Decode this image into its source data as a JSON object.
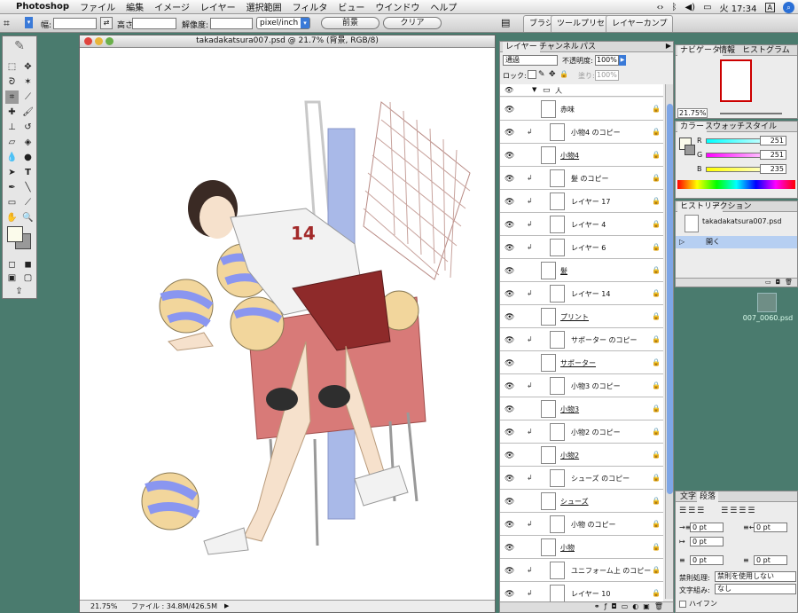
{
  "menubar": {
    "app": "Photoshop",
    "items": [
      "ファイル",
      "編集",
      "イメージ",
      "レイヤー",
      "選択範囲",
      "フィルタ",
      "ビュー",
      "ウインドウ",
      "ヘルプ"
    ],
    "clock": "火 17:34"
  },
  "options": {
    "width_label": "幅:",
    "height_label": "高さ:",
    "resolution_label": "解像度:",
    "unit": "pixel/inch",
    "front_btn": "前景",
    "clear_btn": "クリア",
    "well_tabs": [
      "ブラシ",
      "ツールプリセット",
      "レイヤーカンプ"
    ]
  },
  "document": {
    "title": "takadakatsura007.psd @ 21.7% (背景, RGB/8)",
    "zoom": "21.75%",
    "file_info": "ファイル : 34.8M/426.5M"
  },
  "layers": {
    "tabs": [
      "レイヤー",
      "チャンネル",
      "パス"
    ],
    "blend": "通過",
    "opacity_label": "不透明度:",
    "opacity": "100%",
    "lock_label": "ロック:",
    "fill_label": "塗り:",
    "fill": "100%",
    "group": "人",
    "rows": [
      {
        "name": "赤味",
        "link": false,
        "indent": false,
        "u": false
      },
      {
        "name": "小物4 のコピー",
        "link": true,
        "indent": true,
        "u": false
      },
      {
        "name": "小物4",
        "link": false,
        "indent": false,
        "u": true
      },
      {
        "name": "髪 のコピー",
        "link": true,
        "indent": true,
        "u": false
      },
      {
        "name": "レイヤー 17",
        "link": true,
        "indent": true,
        "u": false
      },
      {
        "name": "レイヤー 4",
        "link": true,
        "indent": true,
        "u": false
      },
      {
        "name": "レイヤー 6",
        "link": true,
        "indent": true,
        "u": false
      },
      {
        "name": "髪",
        "link": false,
        "indent": false,
        "u": true
      },
      {
        "name": "レイヤー 14",
        "link": true,
        "indent": true,
        "u": false
      },
      {
        "name": "プリント",
        "link": false,
        "indent": false,
        "u": true
      },
      {
        "name": "サポーター のコピー",
        "link": true,
        "indent": true,
        "u": false
      },
      {
        "name": "サポーター",
        "link": false,
        "indent": false,
        "u": true
      },
      {
        "name": "小物3 のコピー",
        "link": true,
        "indent": true,
        "u": false
      },
      {
        "name": "小物3",
        "link": false,
        "indent": false,
        "u": true
      },
      {
        "name": "小物2 のコピー",
        "link": true,
        "indent": true,
        "u": false
      },
      {
        "name": "小物2",
        "link": false,
        "indent": false,
        "u": true
      },
      {
        "name": "シューズ のコピー",
        "link": true,
        "indent": true,
        "u": false
      },
      {
        "name": "シューズ",
        "link": false,
        "indent": false,
        "u": true
      },
      {
        "name": "小物 のコピー",
        "link": true,
        "indent": true,
        "u": false
      },
      {
        "name": "小物",
        "link": false,
        "indent": false,
        "u": true
      },
      {
        "name": "ユニフォーム上 のコピー",
        "link": true,
        "indent": true,
        "u": false
      },
      {
        "name": "レイヤー 10",
        "link": true,
        "indent": true,
        "u": false
      }
    ]
  },
  "navigator": {
    "tabs": [
      "ナビゲータ",
      "情報",
      "ヒストグラム"
    ],
    "zoom": "21.75%"
  },
  "color": {
    "tabs": [
      "カラー",
      "スウォッチ",
      "スタイル"
    ],
    "r_label": "R",
    "g_label": "G",
    "b_label": "B",
    "r": "251",
    "g": "251",
    "b": "235"
  },
  "history": {
    "tabs": [
      "ヒストリー",
      "アクション"
    ],
    "snapshot": "takadakatsura007.psd",
    "open_label": "開く"
  },
  "text": {
    "tabs": [
      "文字",
      "段落"
    ],
    "indent_values": [
      "0 pt",
      "0 pt",
      "0 pt",
      "0 pt",
      "0 pt"
    ],
    "kinsoku_label": "禁則処理:",
    "kinsoku_value": "禁則を使用しない",
    "mojikumi_label": "文字組み:",
    "mojikumi_value": "なし",
    "hyphen_label": "ハイフン"
  },
  "desktop": {
    "file_label": "007_0060.psd"
  }
}
